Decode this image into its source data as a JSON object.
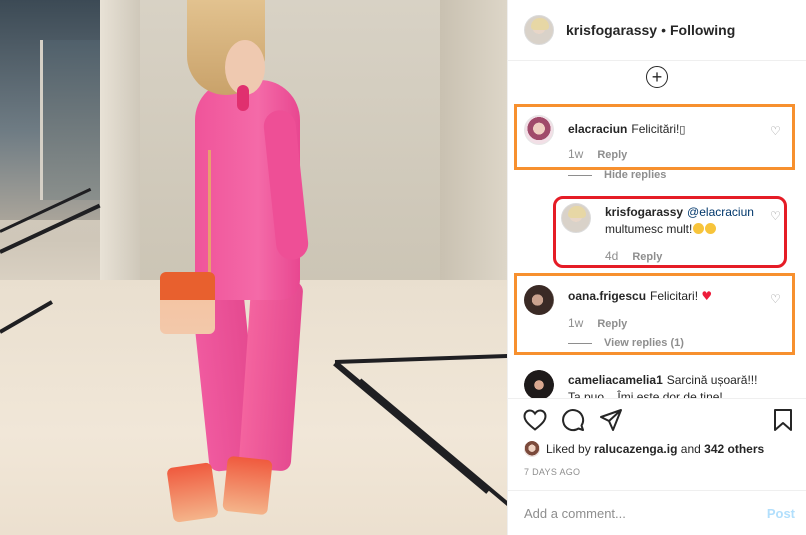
{
  "post": {
    "author": "krisfogarassy",
    "separator": "•",
    "follow_status": "Following"
  },
  "comments": [
    {
      "username": "elacraciun",
      "text": "Felicitări!",
      "emoji": "▯",
      "time": "1w",
      "reply_label": "Reply",
      "replies_toggle": "Hide replies",
      "reply": {
        "username": "krisfogarassy",
        "mention": "@elacraciun",
        "text": "multumesc mult!",
        "time": "4d",
        "reply_label": "Reply"
      }
    },
    {
      "username": "oana.frigescu",
      "text": "Felicitari!",
      "emoji": "♥",
      "time": "1w",
      "reply_label": "Reply",
      "replies_toggle": "View replies (1)"
    },
    {
      "username": "cameliacamelia1",
      "text": "Sarcină ușoară!!!",
      "text_line2": "Ta puo... Îmi este dor de tine!"
    }
  ],
  "likes": {
    "prefix": "Liked by",
    "liker": "ralucazenga.ig",
    "and": "and",
    "others": "342 others"
  },
  "time_ago": "7 DAYS AGO",
  "add_comment": {
    "placeholder": "Add a comment...",
    "post_label": "Post"
  },
  "highlight_colors": {
    "orange": "#f7902e",
    "red": "#e51c26"
  },
  "icons": [
    "heart-icon",
    "comment-icon",
    "share-icon",
    "bookmark-icon",
    "plus-circle-icon"
  ]
}
